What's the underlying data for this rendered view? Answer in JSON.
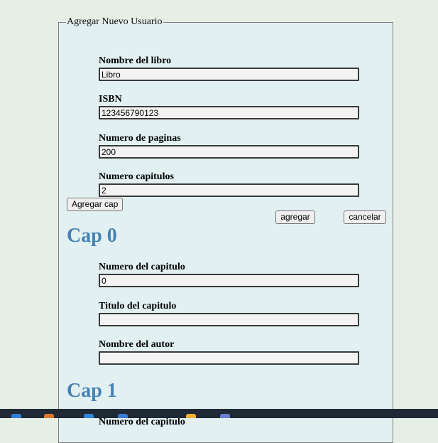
{
  "form": {
    "legend": "Agregar Nuevo Usuario",
    "fields": {
      "book_name": {
        "label": "Nombre del libro",
        "value": "Libro"
      },
      "isbn": {
        "label": "ISBN",
        "value": "123456790123"
      },
      "pages": {
        "label": "Numero de paginas",
        "value": "200"
      },
      "chapters": {
        "label": "Numero capitulos",
        "value": "2"
      }
    },
    "buttons": {
      "add_cap": "Agregar cap",
      "agregar": "agregar",
      "cancelar": "cancelar"
    }
  },
  "chapters": [
    {
      "heading": "Cap 0",
      "number_label": "Numero del capitulo",
      "number_value": "0",
      "title_label": "Titulo del capitulo",
      "title_value": "",
      "author_label": "Nombre del autor",
      "author_value": ""
    },
    {
      "heading": "Cap 1",
      "number_label": "Numero del capitulo"
    }
  ],
  "taskbar": {
    "icons": [
      {
        "name": "edge-icon",
        "color": "#2f7fd6"
      },
      {
        "name": "file-explorer-icon",
        "color": "#e0742b"
      },
      {
        "name": "store-icon",
        "color": "#2e86de"
      },
      {
        "name": "mail-icon",
        "color": "#3a7bd5"
      },
      {
        "name": "chrome-icon",
        "color": "#f2b233"
      },
      {
        "name": "app-icon",
        "color": "#6b7bd8"
      }
    ]
  }
}
